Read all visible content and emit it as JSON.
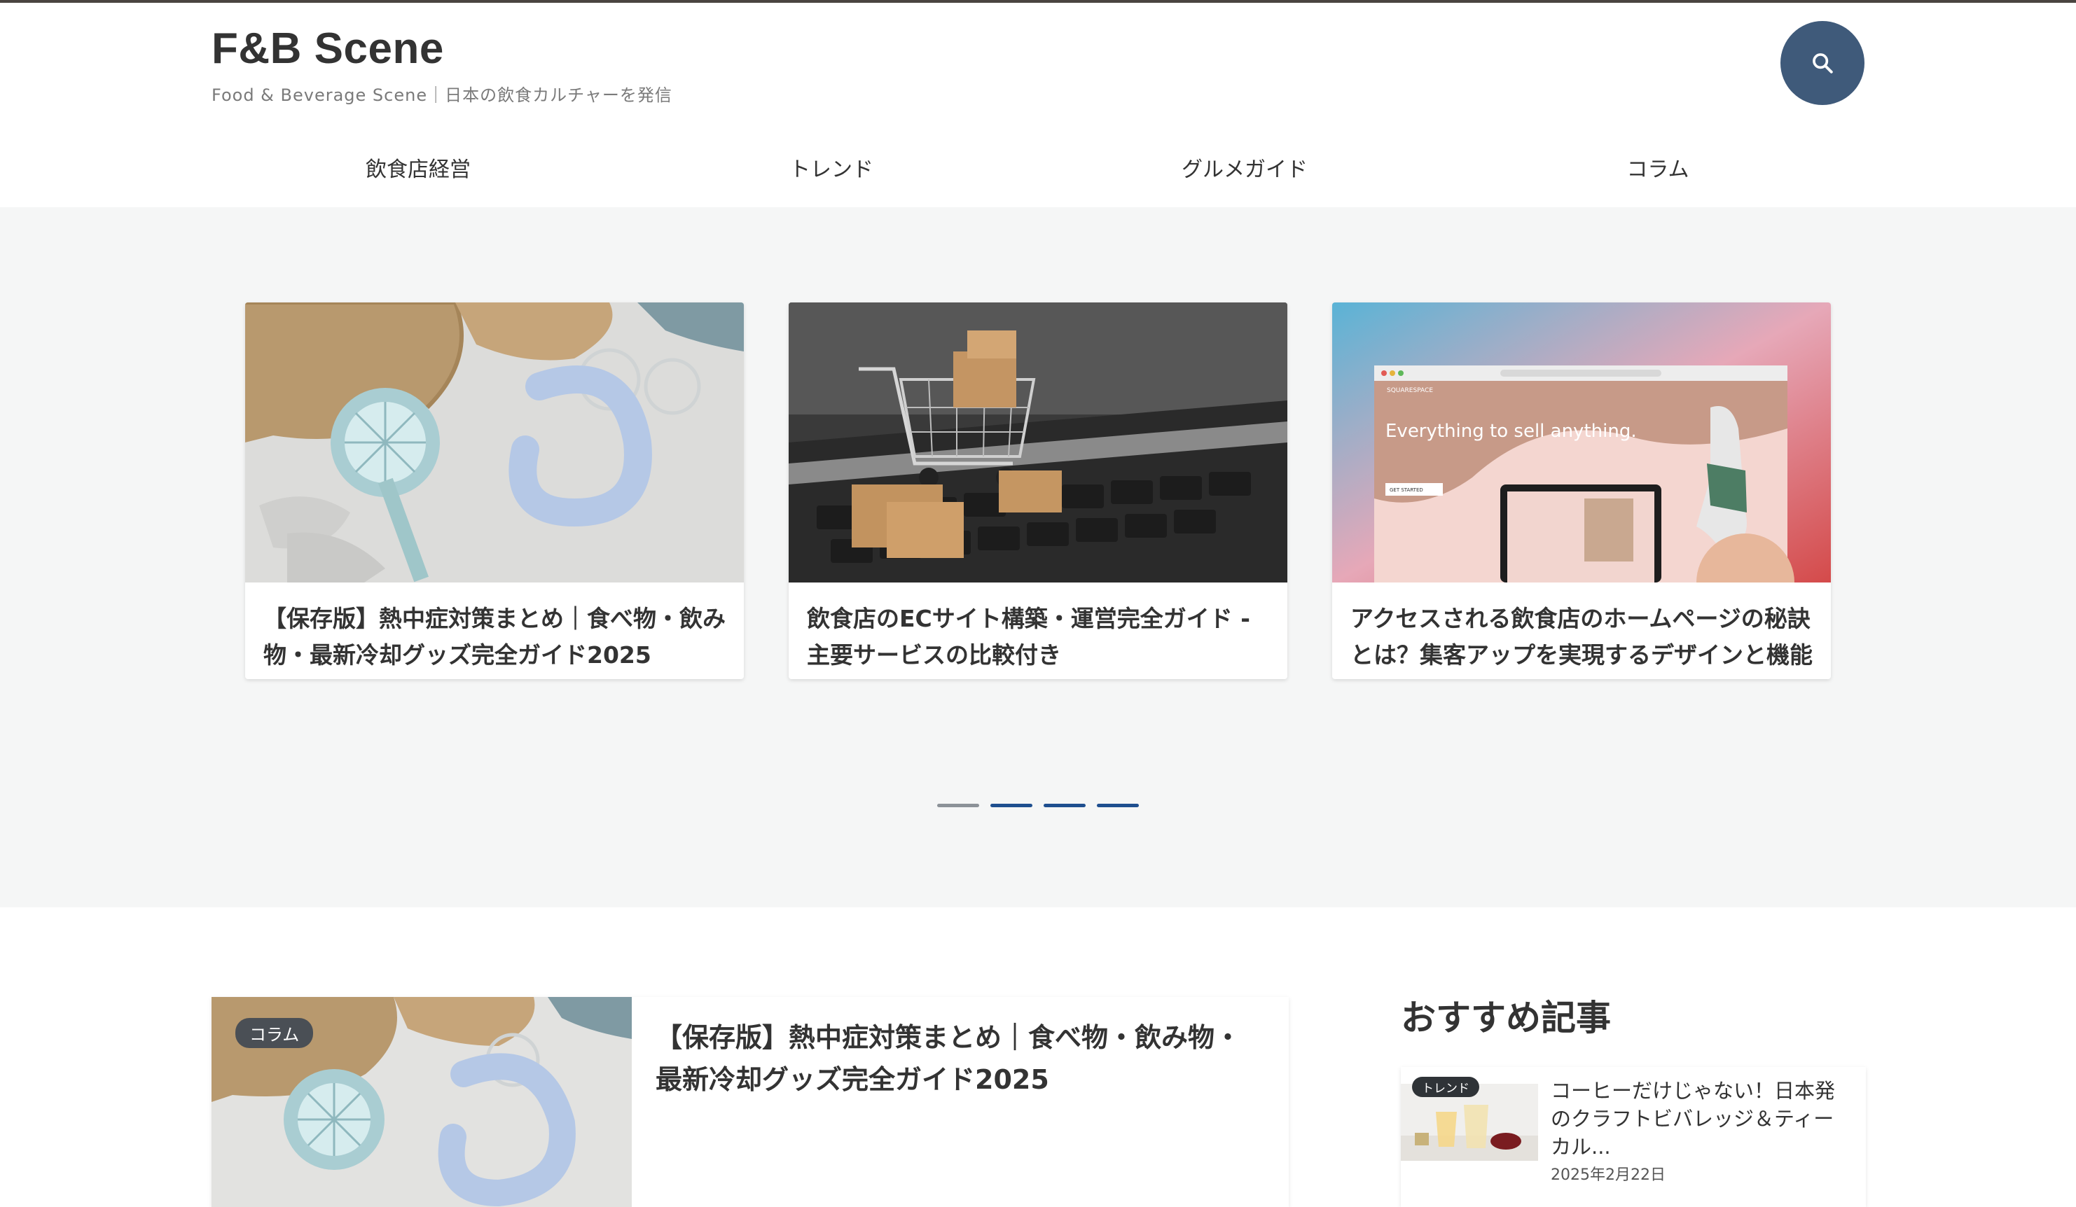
{
  "site": {
    "title": "F&B Scene",
    "tagline": "Food & Beverage Scene｜日本の飲食カルチャーを発信"
  },
  "nav": {
    "items": [
      "飲食店経営",
      "トレンド",
      "グルメガイド",
      "コラム"
    ]
  },
  "hero": {
    "cards": [
      {
        "title": "【保存版】熱中症対策まとめ｜食べ物・飲み物・最新冷却グッズ完全ガイド2025",
        "image": "summer-cooling-goods-photo"
      },
      {
        "title": "飲食店のECサイト構築・運営完全ガイド - 主要サービスの比較付き",
        "image": "shopping-cart-on-keyboard-photo"
      },
      {
        "title": "アクセスされる飲食店のホームページの秘訣とは？集客アップを実現するデザインと機能",
        "image": "website-builder-screenshot-photo",
        "image_text": {
          "headline": "Everything to sell anything.",
          "brand": "SQUARESPACE",
          "cta": "GET STARTED"
        }
      }
    ],
    "pagination": {
      "count": 4,
      "active_index": 0
    }
  },
  "featured": {
    "category": "コラム",
    "title": "【保存版】熱中症対策まとめ｜食べ物・飲み物・最新冷却グッズ完全ガイド2025"
  },
  "sidebar": {
    "heading": "おすすめ記事",
    "items": [
      {
        "category": "トレンド",
        "title": "コーヒーだけじゃない！日本発のクラフトビバレッジ＆ティーカル...",
        "date": "2025年2月22日"
      }
    ]
  },
  "colors": {
    "search_button": "#3f5a7a",
    "pagination_active": "#1f4f8f",
    "hero_background": "#f5f6f6",
    "badge": "#4a4f55"
  }
}
